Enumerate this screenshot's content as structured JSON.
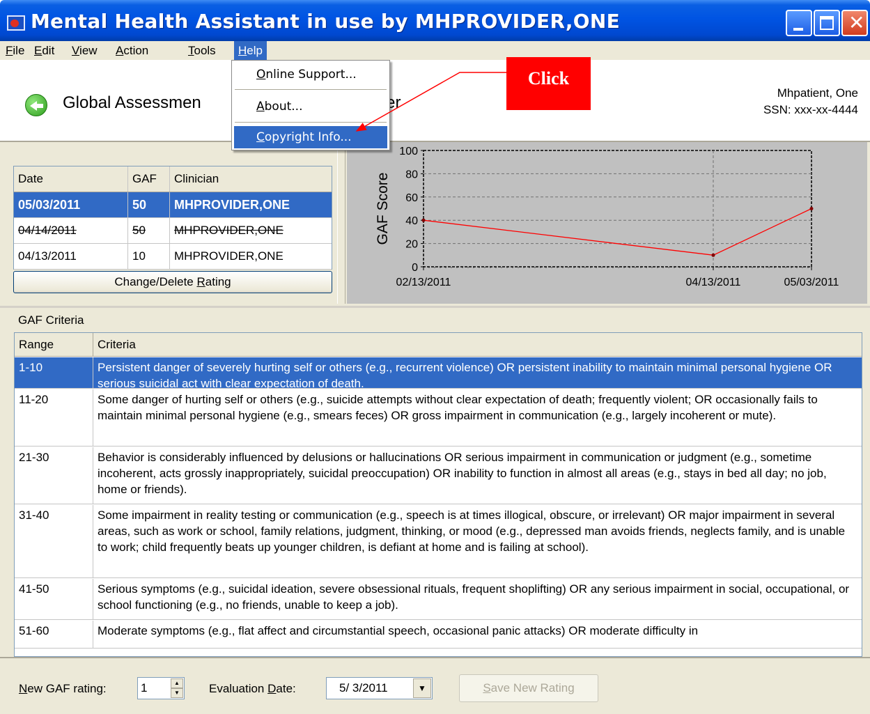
{
  "window": {
    "title": "Mental Health Assistant in use by MHPROVIDER,ONE",
    "close_glyph": "✕"
  },
  "menubar": {
    "items": [
      "File",
      "Edit",
      "View",
      "Action",
      "Tools",
      "Help"
    ],
    "active": "Help"
  },
  "help_menu": {
    "items": [
      "Online Support...",
      "About...",
      "Copyright Info..."
    ],
    "selected": "Copyright Info..."
  },
  "callout": {
    "text": "Click",
    "color": "#ff0000"
  },
  "header": {
    "title": "Global Assessment of Functioning Manager",
    "title_visible_left": "Global Assessmen",
    "title_visible_right": "Manager",
    "patient_name": "Mhpatient, One",
    "patient_ssn": "SSN: xxx-xx-4444"
  },
  "ratings": {
    "columns": [
      "Date",
      "GAF",
      "Clinician"
    ],
    "rows": [
      {
        "date": "05/03/2011",
        "gaf": "50",
        "clinician": "MHPROVIDER,ONE",
        "state": "selected"
      },
      {
        "date": "04/14/2011",
        "gaf": "50",
        "clinician": "MHPROVIDER,ONE",
        "state": "deleted"
      },
      {
        "date": "04/13/2011",
        "gaf": "10",
        "clinician": "MHPROVIDER,ONE",
        "state": "normal"
      }
    ],
    "change_button": "Change/Delete Rating"
  },
  "chart_data": {
    "type": "line",
    "ylabel": "GAF Score",
    "ylim": [
      0,
      100
    ],
    "yticks": [
      0,
      20,
      40,
      60,
      80,
      100
    ],
    "x_tick_labels": [
      "02/13/2011",
      "04/13/2011",
      "05/03/2011"
    ],
    "grid": true,
    "series": [
      {
        "color": "#ff0000",
        "points": [
          {
            "x": "02/13/2011",
            "y": 40
          },
          {
            "x": "04/13/2011",
            "y": 10
          },
          {
            "x": "05/03/2011",
            "y": 50
          }
        ]
      }
    ]
  },
  "criteria": {
    "section_label": "GAF Criteria",
    "columns": [
      "Range",
      "Criteria"
    ],
    "rows": [
      {
        "range": "1-10",
        "text": "Persistent danger of severely hurting self or others (e.g., recurrent violence) OR persistent inability to maintain minimal personal hygiene OR serious suicidal act with clear expectation of death."
      },
      {
        "range": "11-20",
        "text": "Some danger of hurting self or others (e.g., suicide attempts without clear expectation of death; frequently violent; OR occasionally fails to maintain minimal personal hygiene (e.g., smears feces) OR gross impairment in communication (e.g., largely incoherent or mute)."
      },
      {
        "range": "21-30",
        "text": "Behavior is considerably influenced by delusions or hallucinations OR serious impairment in communication or judgment (e.g., sometime incoherent, acts grossly inappropriately, suicidal preoccupation) OR inability to function in almost all areas (e.g., stays in bed all day; no job, home or friends)."
      },
      {
        "range": "31-40",
        "text": "Some impairment in reality testing or communication (e.g., speech is at times illogical, obscure, or irrelevant) OR major impairment in several areas, such as work or school, family relations, judgment, thinking, or mood (e.g., depressed man avoids friends, neglects family, and is unable to work; child frequently beats up younger children, is defiant at home and is failing at school)."
      },
      {
        "range": "41-50",
        "text": "Serious symptoms (e.g., suicidal ideation, severe obsessional rituals, frequent shoplifting) OR any serious impairment in social, occupational, or school functioning (e.g., no friends, unable to keep a job)."
      },
      {
        "range": "51-60",
        "text": "Moderate symptoms (e.g., flat affect and circumstantial speech, occasional panic attacks) OR moderate difficulty in"
      }
    ]
  },
  "bottom": {
    "new_rating_label_first": "N",
    "new_rating_label_rest": "ew GAF rating:",
    "new_rating_value": "1",
    "eval_label_start": "Evaluation ",
    "eval_label_u": "D",
    "eval_label_end": "ate:",
    "eval_date": "5/ 3/2011",
    "save_button_first": "S",
    "save_button_rest": "ave New Rating",
    "spin_up": "▲",
    "spin_down": "▼",
    "date_drop": "▼"
  },
  "colors": {
    "selection": "#316ac5",
    "titlebar": "#0054e3",
    "chart_bg": "#c0c0c0",
    "series": "#ff0000"
  }
}
